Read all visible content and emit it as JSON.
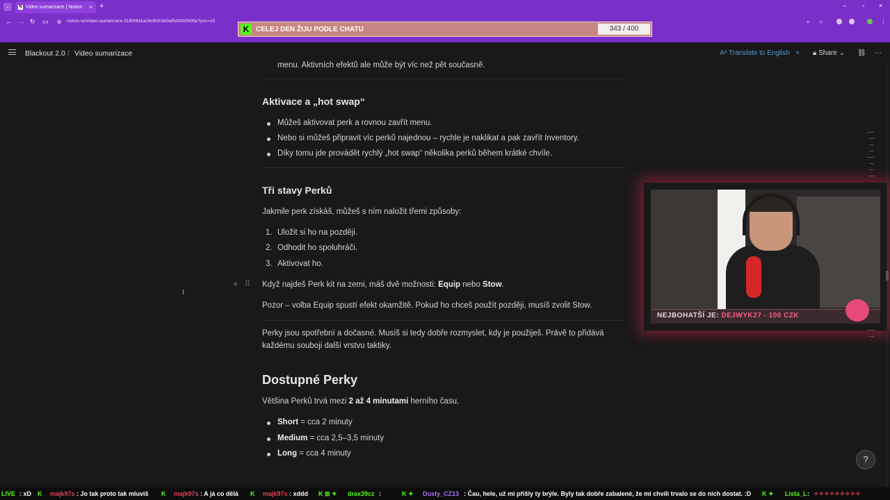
{
  "browser": {
    "tab_title": "Video sumarizace | Notion",
    "tab_favicon": "N",
    "url": "notion.so/Video-sumarizace-3180f4d1a24c8001bf3af5df330f405e?pvs=10",
    "new_tab_symbol": "+",
    "close_symbol": "×",
    "window_controls": [
      "–",
      "▫",
      "×"
    ]
  },
  "overlay": {
    "goal_text": "CELEJ DEN ŽIJU PODLE CHATU",
    "goal_count": "343 / 400",
    "brand_letter": "K"
  },
  "notion": {
    "breadcrumb": [
      "Blackout 2.0",
      "Video sumarizace"
    ],
    "separator": "/",
    "translate_label": "Translate to English",
    "share_label": "Share"
  },
  "doc": {
    "top_fragment": "menu. Aktivních efektů ale může být víc než pět současně.",
    "section1_title": "Aktivace a „hot swap“",
    "section1_bullets": [
      "Můžeš aktivovat perk a rovnou zavřít menu.",
      "Nebo si můžeš připravit víc perků najednou – rychle je naklikat a pak zavřít Inventory.",
      "Díky tomu jde provádět rychlý „hot swap“ několika perků během krátké chvíle."
    ],
    "section2_title": "Tři stavy Perků",
    "section2_intro": "Jakmile perk získáš, můžeš s ním naložit třemi způsoby:",
    "section2_list": [
      "Uložit si ho na později.",
      "Odhodit ho spoluhráči.",
      "Aktivovat ho."
    ],
    "kit_text_before": "Když najdeš Perk kit na zemi, máš dvě možnosti: ",
    "kit_equip": "Equip",
    "kit_or": " nebo ",
    "kit_stow": "Stow",
    "kit_end": ".",
    "warning": "Pozor – volba Equip spustí efekt okamžitě. Pokud ho chceš použít později, musíš zvolit Stow.",
    "summary_line1": "Perky jsou spotřební a dočasné. Musíš si tedy dobře rozmyslet, kdy je použiješ. Právě to přidává",
    "summary_line2": "každému souboji další vrstvu taktiky.",
    "section3_title": "Dostupné Perky",
    "section3_intro_before": "Většina Perků trvá mezi ",
    "section3_intro_bold": "2 až 4 minutami",
    "section3_intro_after": " herního času.",
    "durations": [
      {
        "name": "Short",
        "value": " = cca 2 minuty"
      },
      {
        "name": "Medium",
        "value": " = cca 2,5–3,5 minuty"
      },
      {
        "name": "Long",
        "value": " = cca 4 minuty"
      }
    ]
  },
  "webcam": {
    "richest_label": "NEJBOHATŠÍ JE: ",
    "richest_value": "DEJWYK27 - 100 CZK"
  },
  "ticker": [
    {
      "user": "LIVE",
      "msg": ": xD",
      "color": "#53fc18"
    },
    {
      "user": "majk97s",
      "msg": ": Jo tak proto tak mluviš",
      "color": "#e0445a"
    },
    {
      "user": "majk97s",
      "msg": ": A já co dělá",
      "color": "#e0445a"
    },
    {
      "user": "majk97s",
      "msg": ": xddd",
      "color": "#e0445a"
    },
    {
      "user": "drax39cz",
      "msg": ":",
      "color": "#53fc18"
    },
    {
      "user": "Dusty_CZ13",
      "msg": ": Čau, hele, už mi přišly ty brýle. Byly tak dobře zabalené, že mi chvíli trvalo se do nich dostat. :D",
      "color": "#a970ff"
    },
    {
      "user": "Lista_L",
      "msg": ":",
      "color": "#53fc18"
    }
  ]
}
